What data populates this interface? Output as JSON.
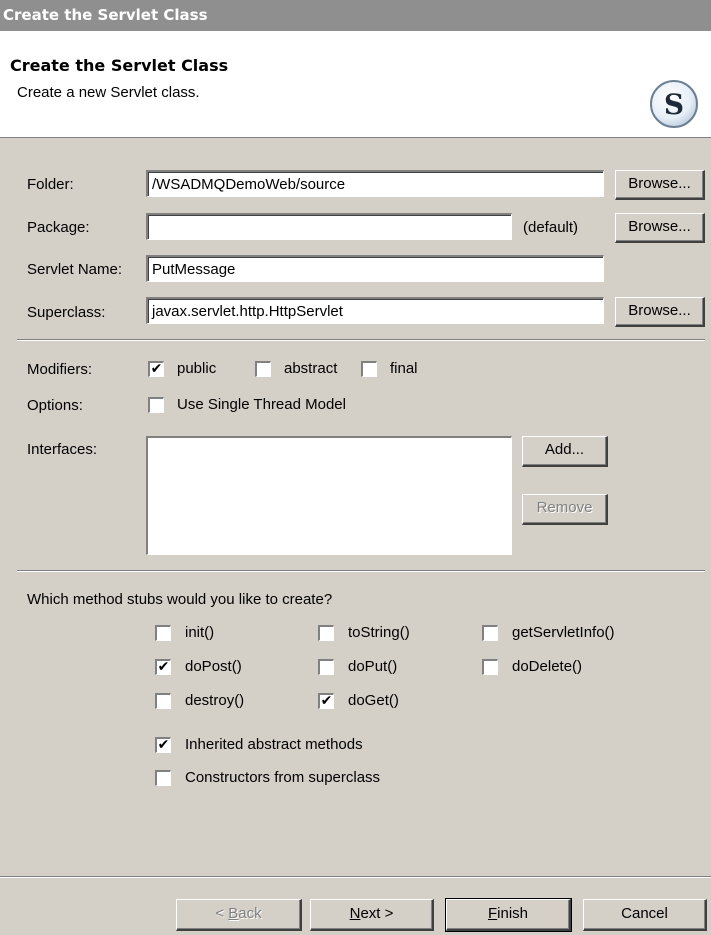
{
  "window": {
    "title": "Create the Servlet Class"
  },
  "banner": {
    "title": "Create the Servlet Class",
    "description": "Create a new Servlet class.",
    "logo_letter": "S"
  },
  "form": {
    "folder": {
      "label": "Folder:",
      "value": "/WSADMQDemoWeb/source",
      "browse": "Browse..."
    },
    "package": {
      "label": "Package:",
      "value": "",
      "hint": "(default)",
      "browse": "Browse..."
    },
    "servlet_name": {
      "label": "Servlet Name:",
      "value": "PutMessage"
    },
    "superclass": {
      "label": "Superclass:",
      "value": "javax.servlet.http.HttpServlet",
      "browse": "Browse..."
    }
  },
  "modifiers": {
    "label": "Modifiers:",
    "public": {
      "label": "public",
      "checked": true
    },
    "abstract": {
      "label": "abstract",
      "checked": false
    },
    "final": {
      "label": "final",
      "checked": false
    }
  },
  "options": {
    "label": "Options:",
    "single_thread": {
      "label": "Use Single Thread Model",
      "checked": false
    }
  },
  "interfaces": {
    "label": "Interfaces:",
    "add": "Add...",
    "remove": "Remove",
    "items": []
  },
  "stubs": {
    "question": "Which method stubs would you like to create?",
    "init": {
      "label": "init()",
      "checked": false
    },
    "toString": {
      "label": "toString()",
      "checked": false
    },
    "getServletInfo": {
      "label": "getServletInfo()",
      "checked": false
    },
    "doPost": {
      "label": "doPost()",
      "checked": true
    },
    "doPut": {
      "label": "doPut()",
      "checked": false
    },
    "doDelete": {
      "label": "doDelete()",
      "checked": false
    },
    "destroy": {
      "label": "destroy()",
      "checked": false
    },
    "doGet": {
      "label": "doGet()",
      "checked": true
    },
    "inherited": {
      "label": "Inherited abstract methods",
      "checked": true
    },
    "constructors": {
      "label": "Constructors from superclass",
      "checked": false
    }
  },
  "buttons": {
    "back": {
      "prefix": "< ",
      "mnemonic": "B",
      "rest": "ack",
      "enabled": false
    },
    "next": {
      "mnemonic": "N",
      "rest": "ext >",
      "enabled": true
    },
    "finish": {
      "mnemonic": "F",
      "rest": "inish",
      "enabled": true
    },
    "cancel": {
      "label": "Cancel",
      "enabled": true
    }
  }
}
